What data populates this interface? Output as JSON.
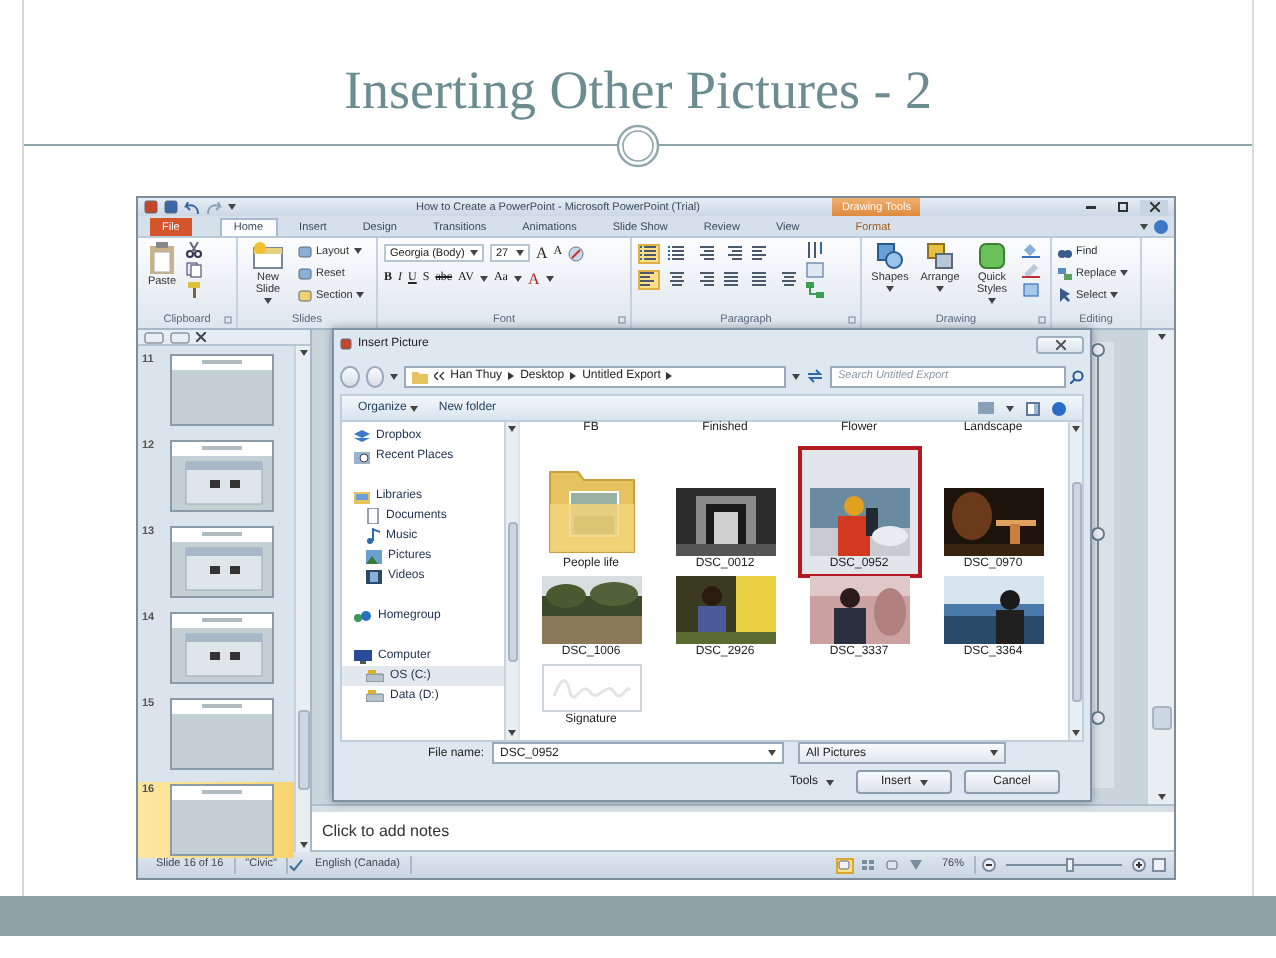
{
  "slide": {
    "title": "Inserting Other Pictures - 2"
  },
  "window": {
    "title": "How to Create a PowerPoint - Microsoft PowerPoint (Trial)",
    "context_label": "Drawing Tools"
  },
  "tabs": [
    {
      "label": "File",
      "kind": "file",
      "selected": false
    },
    {
      "label": "Home",
      "kind": "normal",
      "selected": true
    },
    {
      "label": "Insert",
      "kind": "normal",
      "selected": false
    },
    {
      "label": "Design",
      "kind": "normal",
      "selected": false
    },
    {
      "label": "Transitions",
      "kind": "normal",
      "selected": false
    },
    {
      "label": "Animations",
      "kind": "normal",
      "selected": false
    },
    {
      "label": "Slide Show",
      "kind": "normal",
      "selected": false
    },
    {
      "label": "Review",
      "kind": "normal",
      "selected": false
    },
    {
      "label": "View",
      "kind": "normal",
      "selected": false
    },
    {
      "label": "Format",
      "kind": "context",
      "selected": false
    }
  ],
  "ribbon": {
    "clipboard": {
      "label": "Clipboard",
      "paste": "Paste"
    },
    "slides": {
      "label": "Slides",
      "new_slide": "New Slide",
      "commands": [
        "Layout",
        "Reset",
        "Section"
      ]
    },
    "font": {
      "label": "Font",
      "name": "Georgia (Body)",
      "size": "27",
      "size_buttons": [
        "A",
        "A"
      ],
      "styles": [
        "B",
        "I",
        "U",
        "S",
        "abc",
        "AV",
        "Aa",
        "A"
      ]
    },
    "paragraph": {
      "label": "Paragraph",
      "top_buttons": [
        {
          "kind": "bullets",
          "on": true
        },
        {
          "kind": "numbering",
          "on": false
        },
        {
          "kind": "outdent",
          "on": false
        },
        {
          "kind": "indent",
          "on": false
        },
        {
          "kind": "spacing",
          "on": false
        }
      ],
      "bottom_buttons": [
        {
          "kind": "left",
          "on": true
        },
        {
          "kind": "center",
          "on": false
        },
        {
          "kind": "right",
          "on": false
        },
        {
          "kind": "justify",
          "on": false
        },
        {
          "kind": "columns",
          "on": false
        },
        {
          "kind": "columns2",
          "on": false
        }
      ]
    },
    "drawing": {
      "label": "Drawing",
      "commands": [
        "Shapes",
        "Arrange",
        "Quick Styles"
      ]
    },
    "editing": {
      "label": "Editing",
      "commands": [
        "Find",
        "Replace",
        "Select"
      ]
    }
  },
  "slides_pane": {
    "thumbnails": [
      {
        "number": "11",
        "kind": "blank",
        "selected": false
      },
      {
        "number": "12",
        "kind": "screenshot",
        "selected": false
      },
      {
        "number": "13",
        "kind": "screenshot",
        "selected": false
      },
      {
        "number": "14",
        "kind": "screenshot",
        "selected": false
      },
      {
        "number": "15",
        "kind": "blank",
        "selected": false
      },
      {
        "number": "16",
        "kind": "blank",
        "selected": true
      }
    ]
  },
  "dialog": {
    "title": "Insert Picture",
    "path": [
      "Han Thuy",
      "Desktop",
      "Untitled Export"
    ],
    "search": {
      "placeholder": "Search Untitled Export"
    },
    "toolbar": [
      "Organize",
      "New folder"
    ],
    "nav_sections": [
      {
        "items": [
          {
            "label": "Dropbox",
            "kind": "dropbox",
            "selected": false
          },
          {
            "label": "Recent Places",
            "kind": "recent",
            "selected": false
          }
        ]
      },
      {
        "items": [
          {
            "label": "Libraries",
            "kind": "library",
            "selected": false,
            "children": [
              {
                "label": "Documents",
                "kind": "documents",
                "selected": false
              },
              {
                "label": "Music",
                "kind": "music",
                "selected": false
              },
              {
                "label": "Pictures",
                "kind": "pictures",
                "selected": false
              },
              {
                "label": "Videos",
                "kind": "videos",
                "selected": false
              }
            ]
          }
        ]
      },
      {
        "items": [
          {
            "label": "Homegroup",
            "kind": "homegroup",
            "selected": false
          }
        ]
      },
      {
        "items": [
          {
            "label": "Computer",
            "kind": "computer",
            "selected": false,
            "children": [
              {
                "label": "OS (C:)",
                "kind": "drive",
                "selected": true
              },
              {
                "label": "Data (D:)",
                "kind": "drive",
                "selected": false
              }
            ]
          }
        ]
      }
    ],
    "files": [
      {
        "label": "FB",
        "kind": "cut",
        "selected": false
      },
      {
        "label": "Finished",
        "kind": "cut",
        "selected": false
      },
      {
        "label": "Flower",
        "kind": "cut",
        "selected": false
      },
      {
        "label": "Landscape",
        "kind": "cut",
        "selected": false
      },
      {
        "label": "People life",
        "kind": "folder",
        "selected": false
      },
      {
        "label": "DSC_0012",
        "selected": false
      },
      {
        "label": "DSC_0952",
        "selected": true
      },
      {
        "label": "DSC_0970",
        "selected": false
      },
      {
        "label": "DSC_1006",
        "selected": false
      },
      {
        "label": "DSC_2926",
        "selected": false
      },
      {
        "label": "DSC_3337",
        "selected": false
      },
      {
        "label": "DSC_3364",
        "selected": false
      },
      {
        "label": "Signature",
        "selected": false
      }
    ],
    "file_name_label": "File name:",
    "file_name": "DSC_0952",
    "file_type": "All Pictures",
    "buttons": [
      {
        "label": "Tools",
        "kind": "menu"
      },
      {
        "label": "Insert",
        "kind": "split"
      },
      {
        "label": "Cancel",
        "kind": "plain"
      }
    ]
  },
  "notes": {
    "prompt": "Click to add notes"
  },
  "status_bar": {
    "slide": "Slide 16 of 16",
    "theme": "\"Civic\"",
    "language": "English (Canada)",
    "views": [
      {
        "kind": "normal",
        "selected": true
      },
      {
        "kind": "sorter",
        "selected": false
      },
      {
        "kind": "reading",
        "selected": false
      },
      {
        "kind": "show",
        "selected": false
      }
    ],
    "zoom": "76%",
    "zoom_slider": {
      "level": 0.55
    }
  }
}
